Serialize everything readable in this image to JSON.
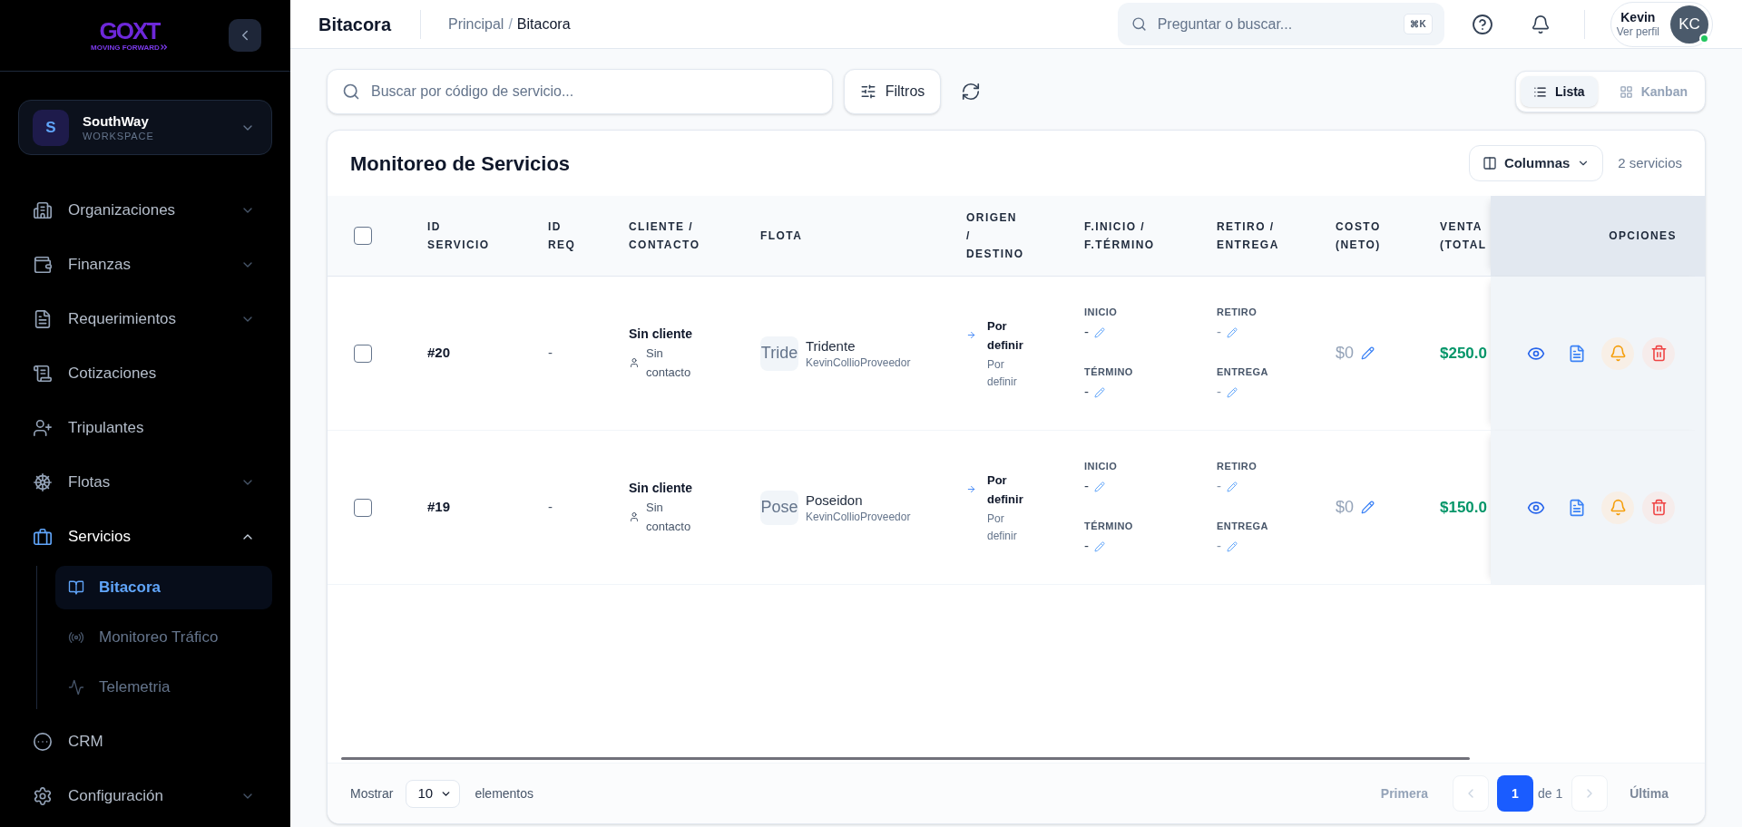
{
  "sidebar": {
    "logo": {
      "wordmark": "GOXT",
      "tagline": "MOVING FORWARD"
    },
    "workspace": {
      "initial": "S",
      "name": "SouthWay",
      "label": "WORKSPACE"
    },
    "nav": [
      {
        "label": "Organizaciones",
        "kind": "group",
        "expanded": false,
        "selected": false
      },
      {
        "label": "Finanzas",
        "kind": "group",
        "expanded": false,
        "selected": false
      },
      {
        "label": "Requerimientos",
        "kind": "group",
        "expanded": false,
        "selected": false
      },
      {
        "label": "Cotizaciones",
        "kind": "link",
        "selected": false
      },
      {
        "label": "Tripulantes",
        "kind": "link",
        "selected": false
      },
      {
        "label": "Flotas",
        "kind": "group",
        "expanded": false,
        "selected": false
      },
      {
        "label": "Servicios",
        "kind": "group",
        "expanded": true,
        "selected": true,
        "children": [
          {
            "label": "Bitacora",
            "selected": true
          },
          {
            "label": "Monitoreo Tráfico",
            "selected": false
          },
          {
            "label": "Telemetria",
            "selected": false
          }
        ]
      },
      {
        "label": "CRM",
        "kind": "link",
        "selected": false
      },
      {
        "label": "Configuración",
        "kind": "group",
        "expanded": false,
        "selected": false
      }
    ]
  },
  "header": {
    "title": "Bitacora",
    "breadcrumb": [
      {
        "label": "Principal"
      },
      {
        "label": "Bitacora"
      }
    ],
    "breadcrumb_separator": "/",
    "search": {
      "placeholder": "Preguntar o buscar...",
      "shortcut": "⌘K"
    },
    "user": {
      "name": "Kevin",
      "subtitle": "Ver perfil",
      "initials": "KC",
      "online": true
    }
  },
  "toolbar": {
    "search": {
      "placeholder": "Buscar por código de servicio..."
    },
    "filter_button": "Filtros",
    "views": [
      {
        "label": "Lista",
        "selected": true
      },
      {
        "label": "Kanban",
        "selected": false
      }
    ]
  },
  "panel": {
    "title": "Monitoreo de Servicios",
    "columns_button": "Columnas",
    "count": "2 servicios",
    "table": {
      "select_all_checked": false,
      "columns": [
        {
          "lines": [
            "ID",
            "SERVICIO"
          ]
        },
        {
          "lines": [
            "ID",
            "REQ"
          ]
        },
        {
          "lines": [
            "CLIENTE /",
            "CONTACTO"
          ]
        },
        {
          "lines": [
            "FLOTA"
          ]
        },
        {
          "lines": [
            "ORIGEN",
            "/",
            "DESTINO"
          ]
        },
        {
          "lines": [
            "F.INICIO /",
            "F.TÉRMINO"
          ]
        },
        {
          "lines": [
            "RETIRO /",
            "ENTREGA"
          ]
        },
        {
          "lines": [
            "COSTO",
            "(NETO)"
          ]
        },
        {
          "lines": [
            "VENTA",
            "(TOTAL"
          ]
        },
        {
          "lines": [
            "OPCIONES"
          ]
        }
      ],
      "rows": [
        {
          "checked": false,
          "id": "#20",
          "req": "-",
          "client": "Sin cliente",
          "contact": "Sin contacto",
          "fleet": {
            "thumbnail": "Tride",
            "name": "Tridente",
            "provider": "KevinCollioProveedor"
          },
          "origin": "Por definir",
          "destination": "Por definir",
          "schedule": [
            {
              "label": "INICIO",
              "value": "-"
            },
            {
              "label": "TÉRMINO",
              "value": "-"
            }
          ],
          "logistics": [
            {
              "label": "RETIRO",
              "value": "-"
            },
            {
              "label": "ENTREGA",
              "value": "-"
            }
          ],
          "cost": "$0",
          "sale": "$250.0"
        },
        {
          "checked": false,
          "id": "#19",
          "req": "-",
          "client": "Sin cliente",
          "contact": "Sin contacto",
          "fleet": {
            "thumbnail": "Pose",
            "name": "Poseidon",
            "provider": "KevinCollioProveedor"
          },
          "origin": "Por definir",
          "destination": "Por definir",
          "schedule": [
            {
              "label": "INICIO",
              "value": "-"
            },
            {
              "label": "TÉRMINO",
              "value": "-"
            }
          ],
          "logistics": [
            {
              "label": "RETIRO",
              "value": "-"
            },
            {
              "label": "ENTREGA",
              "value": "-"
            }
          ],
          "cost": "$0",
          "sale": "$150.0"
        }
      ]
    },
    "footer": {
      "show_label": "Mostrar",
      "page_size": "10",
      "items_label": "elementos",
      "first": {
        "label": "Primera",
        "disabled": true
      },
      "prev_disabled": true,
      "pages": [
        {
          "label": "1",
          "selected": true
        }
      ],
      "of_label": "de 1",
      "next_disabled": true,
      "last": {
        "label": "Última",
        "disabled": false
      }
    }
  }
}
